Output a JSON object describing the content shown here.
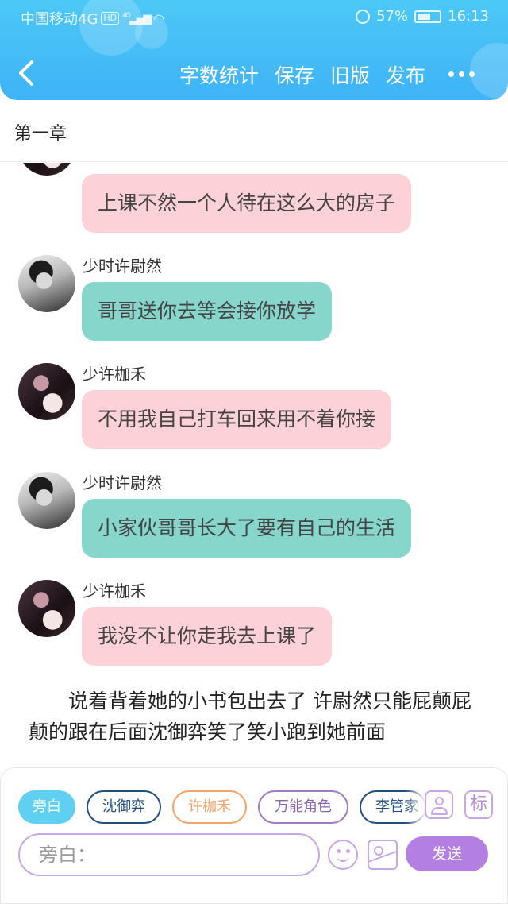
{
  "status_bar": {
    "carrier": "中国移动4G",
    "hd": "HD",
    "signal": "4G",
    "battery": "57%",
    "time": "16:13"
  },
  "toolbar": {
    "back_icon": "chevron-left-icon",
    "actions": [
      "字数统计",
      "保存",
      "旧版",
      "发布"
    ],
    "more_icon": "more-dots-icon"
  },
  "chapter": {
    "title": "第一章"
  },
  "messages": [
    {
      "speaker": "",
      "avatar": "girl-avatar",
      "text": "上课不然一个人待在这么大的房子",
      "color": "#fdd1d8"
    },
    {
      "speaker": "少时许尉然",
      "avatar": "boy-avatar",
      "text": "哥哥送你去等会接你放学",
      "color": "#86d6cc"
    },
    {
      "speaker": "少许枷禾",
      "avatar": "girl-avatar",
      "text": "不用我自己打车回来用不着你接",
      "color": "#fdd1d8"
    },
    {
      "speaker": "少时许尉然",
      "avatar": "boy-avatar",
      "text": "小家伙哥哥长大了要有自己的生活",
      "color": "#86d6cc"
    },
    {
      "speaker": "少许枷禾",
      "avatar": "girl-avatar",
      "text": "我没不让你走我去上课了",
      "color": "#fdd1d8"
    }
  ],
  "narration": "说着背着她的小书包出去了 许尉然只能屁颠屁颠的跟在后面沈御弈笑了笑小跑到她前面",
  "composer": {
    "roles": [
      "旁白",
      "沈御弈",
      "许枷禾",
      "万能角色",
      "李管家"
    ],
    "active_role": "旁白",
    "mark_label": "标",
    "input_placeholder": "旁白：",
    "send_label": "发送",
    "accent": "#b47fe2"
  }
}
